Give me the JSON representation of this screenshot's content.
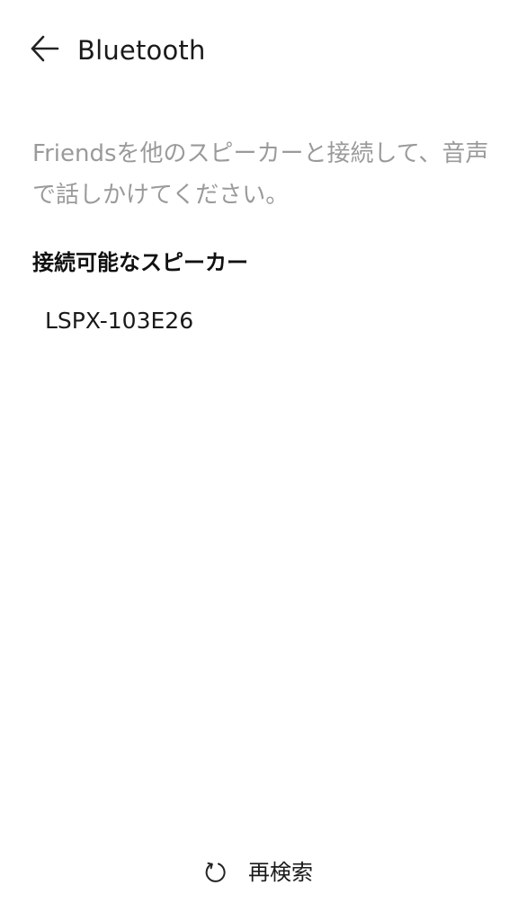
{
  "header": {
    "title": "Bluetooth",
    "back_icon": "arrow-left-icon"
  },
  "content": {
    "description": "Friendsを他のスピーカーと接続して、音声で話しかけてください。",
    "section_title": "接続可能なスピーカー",
    "speakers": [
      {
        "name": "LSPX-103E26"
      }
    ]
  },
  "footer": {
    "rescan_label": "再検索",
    "rescan_icon": "refresh-icon"
  },
  "colors": {
    "background": "#ffffff",
    "primary_text": "#1a1a1a",
    "secondary_text": "#9a9a9a"
  }
}
